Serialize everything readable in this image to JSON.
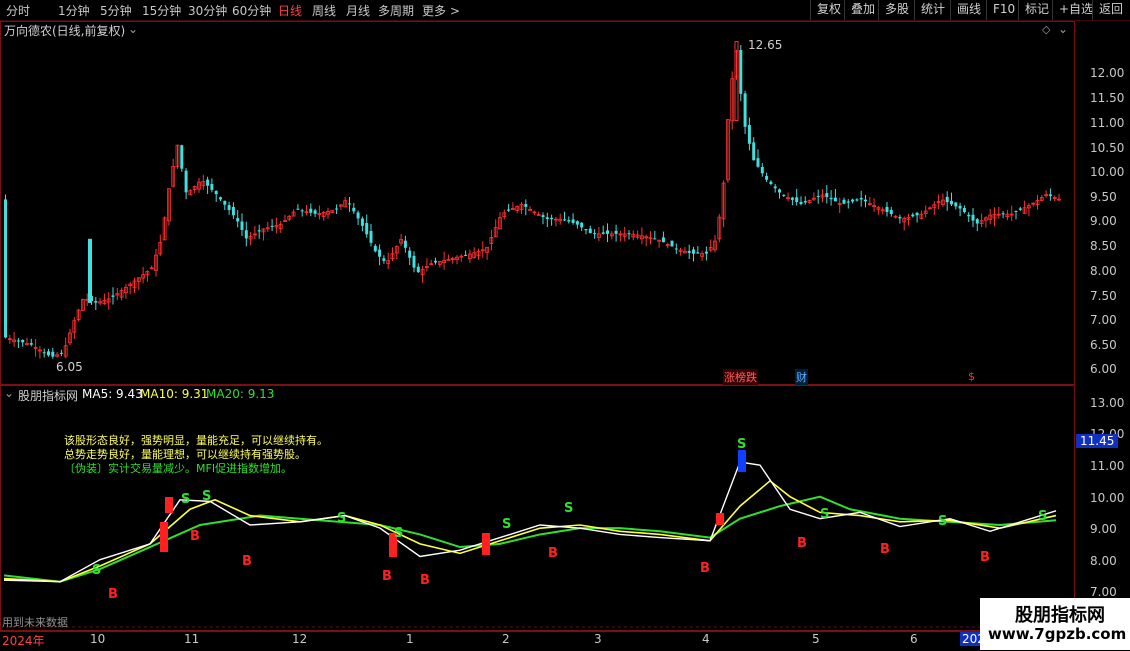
{
  "toolbar": {
    "periods": [
      "分时",
      "1分钟",
      "5分钟",
      "15分钟",
      "30分钟",
      "60分钟",
      "日线",
      "周线",
      "月线",
      "多周期",
      "更多 >"
    ],
    "active_period": "日线",
    "right_buttons": [
      "复权",
      "叠加",
      "多股",
      "统计",
      "画线",
      "F10",
      "标记",
      "+自选",
      "返回"
    ]
  },
  "price_panel": {
    "title": "万向德农(日线,前复权)",
    "high_label": "12.65",
    "low_label": "6.05",
    "axis_ticks": [
      "12.00",
      "11.50",
      "11.00",
      "10.50",
      "10.00",
      "9.50",
      "9.00",
      "8.50",
      "8.00",
      "7.50",
      "7.00",
      "6.50",
      "6.00"
    ],
    "tags": {
      "limit_list": "涨榜跌",
      "finance": "财",
      "dividend": "$"
    }
  },
  "indicator_panel": {
    "name": "股朋指标网",
    "ma5_label": "MA5: 9.43",
    "ma10_label": "MA10: 9.31",
    "ma20_label": "MA20: 9.13",
    "axis_ticks": [
      "13.00",
      "12.00",
      "11.00",
      "10.00",
      "9.00",
      "8.00",
      "7.00"
    ],
    "current_value": "11.45",
    "comments": [
      "该股形态良好，强势明显，量能充足，可以继续持有。",
      "总势走势良好，量能理想，可以继续持有强势股。",
      "〔伪装〕实计交易量减少。MFI促进指数增加。"
    ],
    "future_data_note": "用到未来数据",
    "signal_b": "B",
    "signal_s": "S"
  },
  "date_axis": {
    "labels": [
      "2024年",
      "10",
      "11",
      "12",
      "1",
      "2",
      "3",
      "4",
      "5",
      "6",
      "2025"
    ]
  },
  "watermark": {
    "title": "股朋指标网",
    "url": "www.7gpzb.com"
  },
  "colors": {
    "up": "#ff3030",
    "down": "#40e0e0",
    "ma5": "#ffffff",
    "ma10": "#ffff40",
    "ma20": "#30e030",
    "border": "#7a1010",
    "buy_signal": "#ff2020",
    "sell_signal": "#30e030"
  }
}
